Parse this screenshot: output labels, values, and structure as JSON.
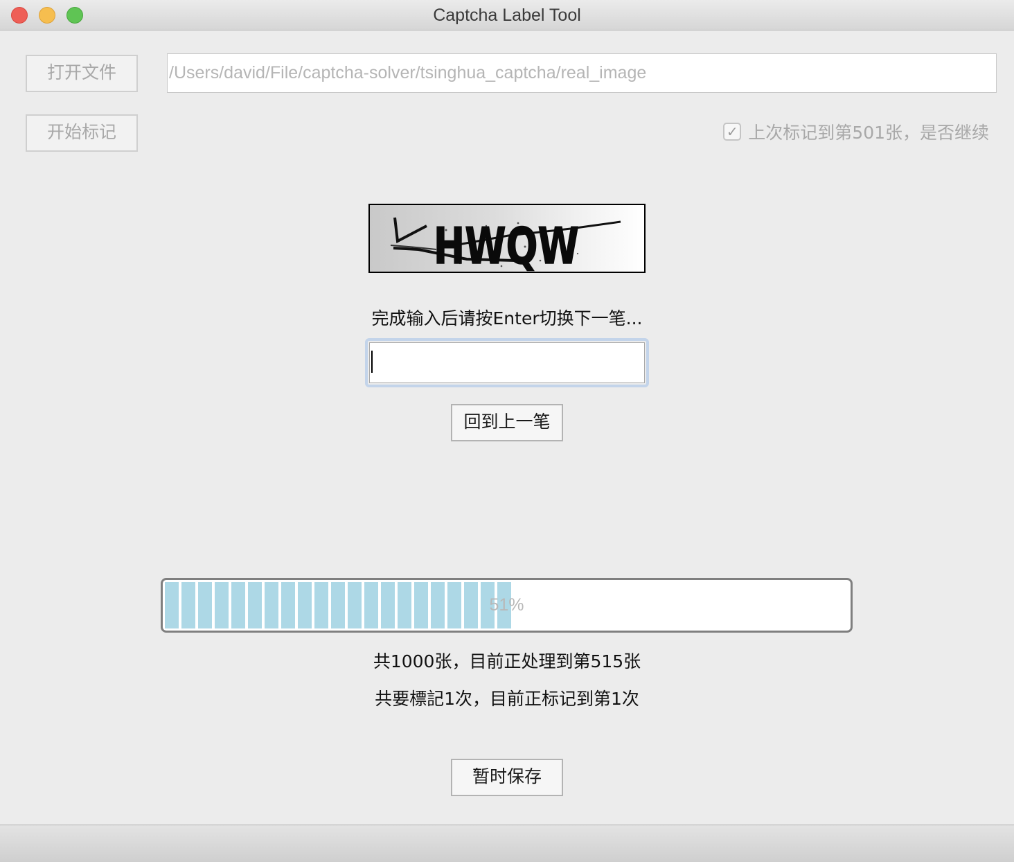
{
  "window": {
    "title": "Captcha Label Tool"
  },
  "toolbar": {
    "open_file_label": "打开文件",
    "start_label": "开始标记",
    "path_value": "/Users/david/File/captcha-solver/tsinghua_captcha/real_image",
    "continue_checked": true,
    "continue_label": "上次标记到第501张，是否继续"
  },
  "captcha": {
    "text": "HWQW"
  },
  "labeling": {
    "instruction": "完成输入后请按Enter切换下一笔...",
    "input_value": "",
    "back_label": "回到上一笔"
  },
  "progress": {
    "percent": 51,
    "text": "51%",
    "fill_color": "#add8e6"
  },
  "status": {
    "line1": "共1000张，目前正处理到第515张",
    "line2": "共要標記1次，目前正标记到第1次"
  },
  "footer": {
    "save_label": "暂时保存"
  }
}
